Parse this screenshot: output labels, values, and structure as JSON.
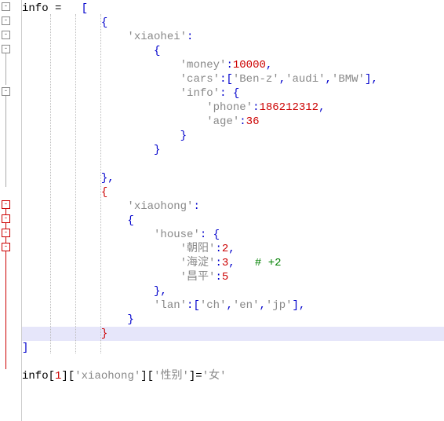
{
  "code": {
    "var_name": "info",
    "assign": " = ",
    "open_bracket": "[",
    "close_bracket": "]",
    "obj1": {
      "key": "'xiaohei'",
      "money_key": "'money'",
      "money_val": "10000",
      "cars_key": "'cars'",
      "cars_vals": [
        "'Ben-z'",
        "'audi'",
        "'BMW'"
      ],
      "info_key": "'info'",
      "phone_key": "'phone'",
      "phone_val": "186212312",
      "age_key": "'age'",
      "age_val": "36"
    },
    "obj2": {
      "key": "'xiaohong'",
      "house_key": "'house'",
      "h1_key": "'朝阳'",
      "h1_val": "2",
      "h2_key": "'海淀'",
      "h2_val": "3",
      "h2_comment": "# +2",
      "h3_key": "'昌平'",
      "h3_val": "5",
      "lan_key": "'lan'",
      "lan_vals": [
        "'ch'",
        "'en'",
        "'jp'"
      ]
    },
    "bottom_line": "info[1]['xiaohong']['性别']='女'"
  }
}
